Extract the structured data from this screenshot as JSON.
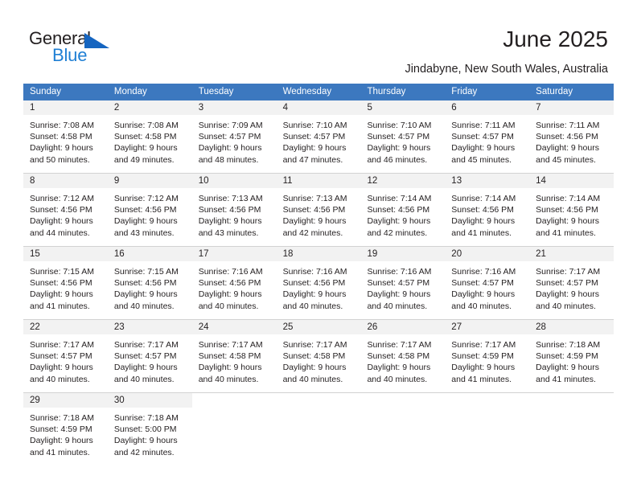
{
  "brand": {
    "name_part1": "General",
    "name_part2": "Blue",
    "accent_color": "#1f7fd4",
    "triangle_color": "#1565c0"
  },
  "header": {
    "title": "June 2025",
    "subtitle": "Jindabyne, New South Wales, Australia"
  },
  "calendar": {
    "header_bg": "#3c78bf",
    "daynum_bg": "#f2f2f2",
    "weekday_headers": [
      "Sunday",
      "Monday",
      "Tuesday",
      "Wednesday",
      "Thursday",
      "Friday",
      "Saturday"
    ],
    "weeks": [
      [
        {
          "day": "1",
          "sunrise": "Sunrise: 7:08 AM",
          "sunset": "Sunset: 4:58 PM",
          "daylight_line1": "Daylight: 9 hours",
          "daylight_line2": "and 50 minutes."
        },
        {
          "day": "2",
          "sunrise": "Sunrise: 7:08 AM",
          "sunset": "Sunset: 4:58 PM",
          "daylight_line1": "Daylight: 9 hours",
          "daylight_line2": "and 49 minutes."
        },
        {
          "day": "3",
          "sunrise": "Sunrise: 7:09 AM",
          "sunset": "Sunset: 4:57 PM",
          "daylight_line1": "Daylight: 9 hours",
          "daylight_line2": "and 48 minutes."
        },
        {
          "day": "4",
          "sunrise": "Sunrise: 7:10 AM",
          "sunset": "Sunset: 4:57 PM",
          "daylight_line1": "Daylight: 9 hours",
          "daylight_line2": "and 47 minutes."
        },
        {
          "day": "5",
          "sunrise": "Sunrise: 7:10 AM",
          "sunset": "Sunset: 4:57 PM",
          "daylight_line1": "Daylight: 9 hours",
          "daylight_line2": "and 46 minutes."
        },
        {
          "day": "6",
          "sunrise": "Sunrise: 7:11 AM",
          "sunset": "Sunset: 4:57 PM",
          "daylight_line1": "Daylight: 9 hours",
          "daylight_line2": "and 45 minutes."
        },
        {
          "day": "7",
          "sunrise": "Sunrise: 7:11 AM",
          "sunset": "Sunset: 4:56 PM",
          "daylight_line1": "Daylight: 9 hours",
          "daylight_line2": "and 45 minutes."
        }
      ],
      [
        {
          "day": "8",
          "sunrise": "Sunrise: 7:12 AM",
          "sunset": "Sunset: 4:56 PM",
          "daylight_line1": "Daylight: 9 hours",
          "daylight_line2": "and 44 minutes."
        },
        {
          "day": "9",
          "sunrise": "Sunrise: 7:12 AM",
          "sunset": "Sunset: 4:56 PM",
          "daylight_line1": "Daylight: 9 hours",
          "daylight_line2": "and 43 minutes."
        },
        {
          "day": "10",
          "sunrise": "Sunrise: 7:13 AM",
          "sunset": "Sunset: 4:56 PM",
          "daylight_line1": "Daylight: 9 hours",
          "daylight_line2": "and 43 minutes."
        },
        {
          "day": "11",
          "sunrise": "Sunrise: 7:13 AM",
          "sunset": "Sunset: 4:56 PM",
          "daylight_line1": "Daylight: 9 hours",
          "daylight_line2": "and 42 minutes."
        },
        {
          "day": "12",
          "sunrise": "Sunrise: 7:14 AM",
          "sunset": "Sunset: 4:56 PM",
          "daylight_line1": "Daylight: 9 hours",
          "daylight_line2": "and 42 minutes."
        },
        {
          "day": "13",
          "sunrise": "Sunrise: 7:14 AM",
          "sunset": "Sunset: 4:56 PM",
          "daylight_line1": "Daylight: 9 hours",
          "daylight_line2": "and 41 minutes."
        },
        {
          "day": "14",
          "sunrise": "Sunrise: 7:14 AM",
          "sunset": "Sunset: 4:56 PM",
          "daylight_line1": "Daylight: 9 hours",
          "daylight_line2": "and 41 minutes."
        }
      ],
      [
        {
          "day": "15",
          "sunrise": "Sunrise: 7:15 AM",
          "sunset": "Sunset: 4:56 PM",
          "daylight_line1": "Daylight: 9 hours",
          "daylight_line2": "and 41 minutes."
        },
        {
          "day": "16",
          "sunrise": "Sunrise: 7:15 AM",
          "sunset": "Sunset: 4:56 PM",
          "daylight_line1": "Daylight: 9 hours",
          "daylight_line2": "and 40 minutes."
        },
        {
          "day": "17",
          "sunrise": "Sunrise: 7:16 AM",
          "sunset": "Sunset: 4:56 PM",
          "daylight_line1": "Daylight: 9 hours",
          "daylight_line2": "and 40 minutes."
        },
        {
          "day": "18",
          "sunrise": "Sunrise: 7:16 AM",
          "sunset": "Sunset: 4:56 PM",
          "daylight_line1": "Daylight: 9 hours",
          "daylight_line2": "and 40 minutes."
        },
        {
          "day": "19",
          "sunrise": "Sunrise: 7:16 AM",
          "sunset": "Sunset: 4:57 PM",
          "daylight_line1": "Daylight: 9 hours",
          "daylight_line2": "and 40 minutes."
        },
        {
          "day": "20",
          "sunrise": "Sunrise: 7:16 AM",
          "sunset": "Sunset: 4:57 PM",
          "daylight_line1": "Daylight: 9 hours",
          "daylight_line2": "and 40 minutes."
        },
        {
          "day": "21",
          "sunrise": "Sunrise: 7:17 AM",
          "sunset": "Sunset: 4:57 PM",
          "daylight_line1": "Daylight: 9 hours",
          "daylight_line2": "and 40 minutes."
        }
      ],
      [
        {
          "day": "22",
          "sunrise": "Sunrise: 7:17 AM",
          "sunset": "Sunset: 4:57 PM",
          "daylight_line1": "Daylight: 9 hours",
          "daylight_line2": "and 40 minutes."
        },
        {
          "day": "23",
          "sunrise": "Sunrise: 7:17 AM",
          "sunset": "Sunset: 4:57 PM",
          "daylight_line1": "Daylight: 9 hours",
          "daylight_line2": "and 40 minutes."
        },
        {
          "day": "24",
          "sunrise": "Sunrise: 7:17 AM",
          "sunset": "Sunset: 4:58 PM",
          "daylight_line1": "Daylight: 9 hours",
          "daylight_line2": "and 40 minutes."
        },
        {
          "day": "25",
          "sunrise": "Sunrise: 7:17 AM",
          "sunset": "Sunset: 4:58 PM",
          "daylight_line1": "Daylight: 9 hours",
          "daylight_line2": "and 40 minutes."
        },
        {
          "day": "26",
          "sunrise": "Sunrise: 7:17 AM",
          "sunset": "Sunset: 4:58 PM",
          "daylight_line1": "Daylight: 9 hours",
          "daylight_line2": "and 40 minutes."
        },
        {
          "day": "27",
          "sunrise": "Sunrise: 7:17 AM",
          "sunset": "Sunset: 4:59 PM",
          "daylight_line1": "Daylight: 9 hours",
          "daylight_line2": "and 41 minutes."
        },
        {
          "day": "28",
          "sunrise": "Sunrise: 7:18 AM",
          "sunset": "Sunset: 4:59 PM",
          "daylight_line1": "Daylight: 9 hours",
          "daylight_line2": "and 41 minutes."
        }
      ],
      [
        {
          "day": "29",
          "sunrise": "Sunrise: 7:18 AM",
          "sunset": "Sunset: 4:59 PM",
          "daylight_line1": "Daylight: 9 hours",
          "daylight_line2": "and 41 minutes."
        },
        {
          "day": "30",
          "sunrise": "Sunrise: 7:18 AM",
          "sunset": "Sunset: 5:00 PM",
          "daylight_line1": "Daylight: 9 hours",
          "daylight_line2": "and 42 minutes."
        },
        {
          "day": "",
          "sunrise": "",
          "sunset": "",
          "daylight_line1": "",
          "daylight_line2": ""
        },
        {
          "day": "",
          "sunrise": "",
          "sunset": "",
          "daylight_line1": "",
          "daylight_line2": ""
        },
        {
          "day": "",
          "sunrise": "",
          "sunset": "",
          "daylight_line1": "",
          "daylight_line2": ""
        },
        {
          "day": "",
          "sunrise": "",
          "sunset": "",
          "daylight_line1": "",
          "daylight_line2": ""
        },
        {
          "day": "",
          "sunrise": "",
          "sunset": "",
          "daylight_line1": "",
          "daylight_line2": ""
        }
      ]
    ]
  }
}
